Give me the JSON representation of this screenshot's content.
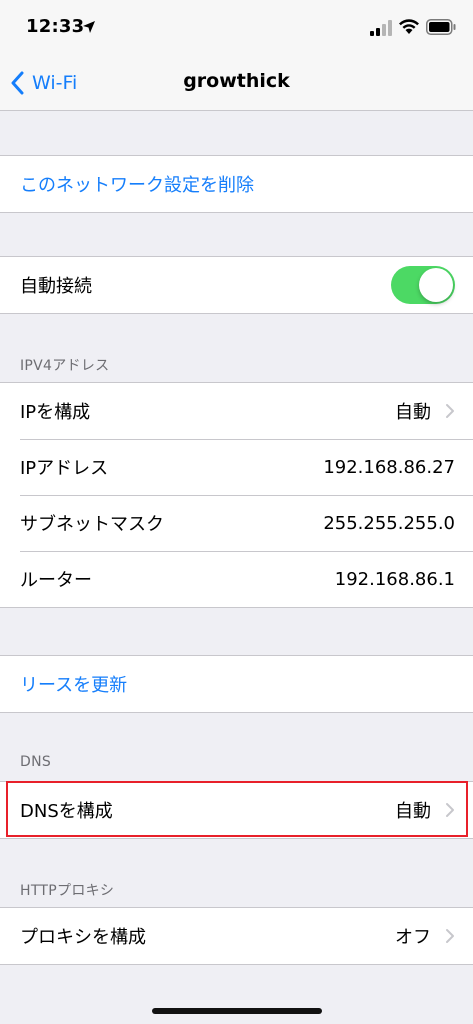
{
  "status_bar": {
    "time": "12:33",
    "icons": [
      "location-arrow-icon",
      "cellular-signal-icon",
      "wifi-icon",
      "battery-icon"
    ]
  },
  "nav": {
    "back_label": "Wi-Fi",
    "title": "growthick"
  },
  "actions": {
    "forget_network": "このネットワーク設定を削除",
    "renew_lease": "リースを更新"
  },
  "auto_join": {
    "label": "自動接続",
    "enabled": true
  },
  "ipv4": {
    "header": "IPV4アドレス",
    "rows": [
      {
        "label": "IPを構成",
        "value": "自動"
      },
      {
        "label": "IPアドレス",
        "value": "192.168.86.27"
      },
      {
        "label": "サブネットマスク",
        "value": "255.255.255.0"
      },
      {
        "label": "ルーター",
        "value": "192.168.86.1"
      }
    ]
  },
  "dns": {
    "header": "DNS",
    "label": "DNSを構成",
    "value": "自動"
  },
  "proxy": {
    "header": "HTTPプロキシ",
    "label": "プロキシを構成",
    "value": "オフ"
  },
  "colors": {
    "accent": "#157efb",
    "toggle_on": "#4cd964",
    "highlight": "#e8202a",
    "background": "#efeff4"
  }
}
